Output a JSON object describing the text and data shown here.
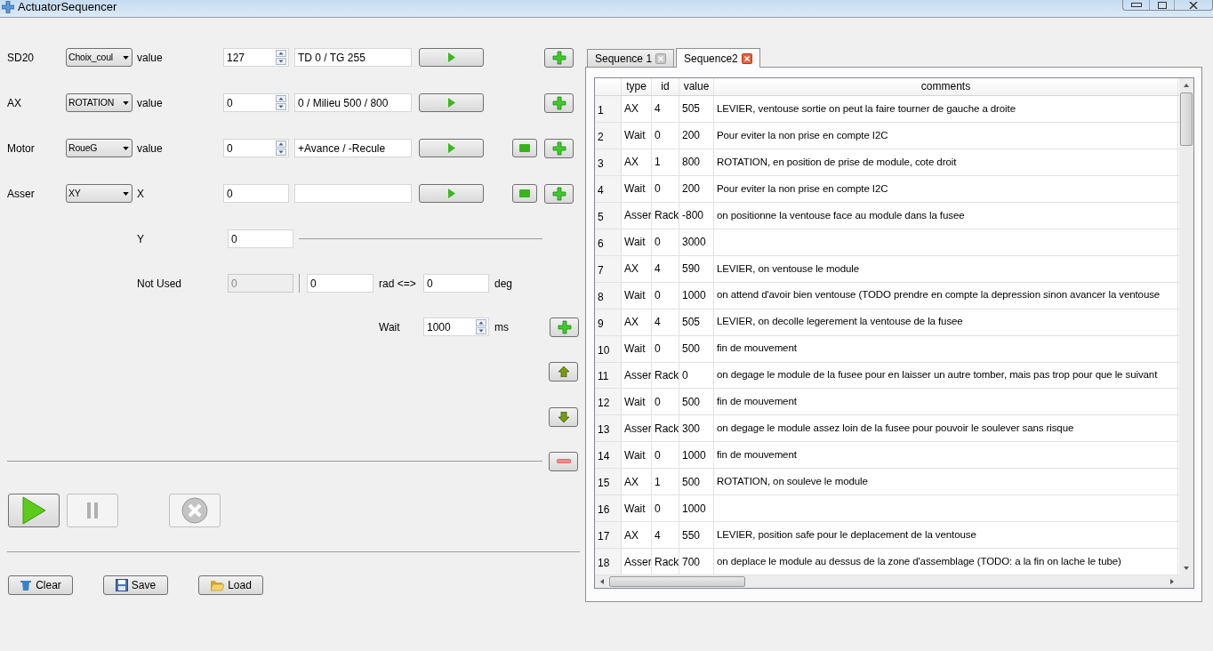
{
  "window": {
    "title": "ActuatorSequencer"
  },
  "actuators": [
    {
      "kind": "spin",
      "label": "SD20",
      "choice": "Choix_coul",
      "param": "value",
      "value": "127",
      "hint": "TD 0 / TG 255",
      "stop_button": false
    },
    {
      "kind": "spin",
      "label": "AX",
      "choice": "ROTATION",
      "param": "value",
      "value": "0",
      "hint": "0 / Milieu 500 / 800",
      "stop_button": false
    },
    {
      "kind": "spin",
      "label": "Motor",
      "choice": "RoueG",
      "param": "value",
      "value": "0",
      "hint": "+Avance / -Recule",
      "stop_button": true
    },
    {
      "kind": "plain",
      "label": "Asser",
      "choice": "XY",
      "param": "X",
      "value": "0",
      "stop_button": true
    }
  ],
  "y_row": {
    "label": "Y",
    "value": "0"
  },
  "angle_row": {
    "label": "Not Used",
    "value": "0",
    "disabled": true,
    "rad": "0",
    "rad_label": "rad <=>",
    "deg": "0",
    "deg_label": "deg"
  },
  "wait_row": {
    "label": "Wait",
    "value": "1000",
    "unit": "ms"
  },
  "run_controls": [
    {
      "kind": "play",
      "disabled": false
    },
    {
      "kind": "pause",
      "disabled": true
    },
    {
      "kind": "stop",
      "disabled": true
    }
  ],
  "file_buttons": [
    {
      "kind": "clear",
      "label": "Clear"
    },
    {
      "kind": "save",
      "label": "Save"
    },
    {
      "kind": "load",
      "label": "Load"
    }
  ],
  "tabs": [
    {
      "label": "Sequence 1",
      "selected": false
    },
    {
      "label": "Sequence2",
      "selected": true
    }
  ],
  "table": {
    "columns": [
      "type",
      "id",
      "value",
      "comments"
    ],
    "rows": [
      {
        "number": "1",
        "type": "AX",
        "id": "4",
        "value": "505",
        "comments": "LEVIER, ventouse sortie on peut la faire tourner de gauche a droite"
      },
      {
        "number": "2",
        "type": "Wait",
        "id": "0",
        "value": "200",
        "comments": "Pour eviter la non prise en compte I2C"
      },
      {
        "number": "3",
        "type": "AX",
        "id": "1",
        "value": "800",
        "comments": "ROTATION, en position de prise de module, cote droit"
      },
      {
        "number": "4",
        "type": "Wait",
        "id": "0",
        "value": "200",
        "comments": "Pour eviter la non prise en compte I2C"
      },
      {
        "number": "5",
        "type": "Asser",
        "id": "Rack",
        "value": "-800",
        "comments": "on positionne la ventouse face au module dans la fusee"
      },
      {
        "number": "6",
        "type": "Wait",
        "id": "0",
        "value": "3000"
      },
      {
        "number": "7",
        "type": "AX",
        "id": "4",
        "value": "590",
        "comments": "LEVIER, on ventouse le module"
      },
      {
        "number": "8",
        "type": "Wait",
        "id": "0",
        "value": "1000",
        "comments": "on attend d'avoir bien ventouse (TODO prendre en compte la depression sinon avancer la ventouse"
      },
      {
        "number": "9",
        "type": "AX",
        "id": "4",
        "value": "505",
        "comments": "LEVIER, on decolle legerement la ventouse de la fusee"
      },
      {
        "number": "10",
        "type": "Wait",
        "id": "0",
        "value": "500",
        "comments": "fin de mouvement"
      },
      {
        "number": "11",
        "type": "Asser",
        "id": "Rack",
        "value": "0",
        "comments": "on degage le module de la fusee pour en laisser un autre tomber, mais pas trop pour que le suivant"
      },
      {
        "number": "12",
        "type": "Wait",
        "id": "0",
        "value": "500",
        "comments": "fin de mouvement"
      },
      {
        "number": "13",
        "type": "Asser",
        "id": "Rack",
        "value": "300",
        "comments": "on degage le module assez loin de la fusee pour pouvoir le soulever sans risque"
      },
      {
        "number": "14",
        "type": "Wait",
        "id": "0",
        "value": "1000",
        "comments": "fin de mouvement"
      },
      {
        "number": "15",
        "type": "AX",
        "id": "1",
        "value": "500",
        "comments": "ROTATION, on souleve le module"
      },
      {
        "number": "16",
        "type": "Wait",
        "id": "0",
        "value": "1000"
      },
      {
        "number": "17",
        "type": "AX",
        "id": "4",
        "value": "550",
        "comments": "LEVIER, position safe pour le deplacement de la ventouse"
      },
      {
        "number": "18",
        "type": "Asser",
        "id": "Rack",
        "value": "700",
        "comments": "on deplace le module au dessus de la zone d'assemblage (TODO: a la fin on lache le tube)"
      }
    ]
  }
}
